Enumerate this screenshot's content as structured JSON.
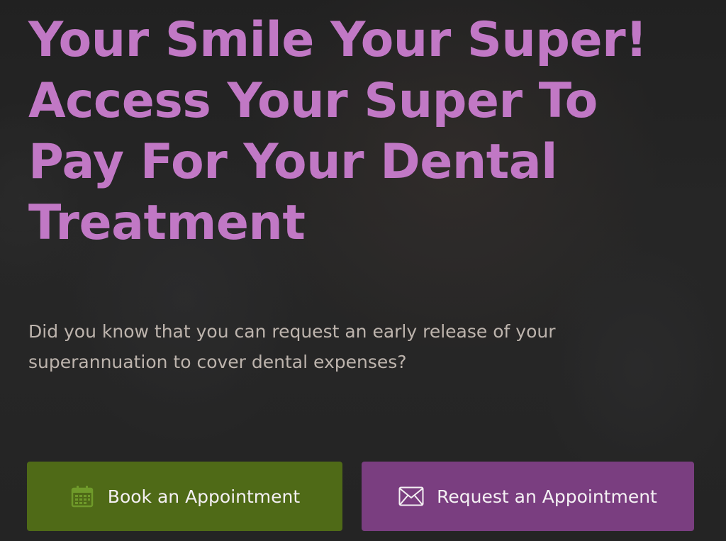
{
  "hero": {
    "headline_lines": [
      "Your Smile Your Super!",
      "Access Your Super To",
      "Pay For Your Dental",
      "Treatment"
    ],
    "intro_lines": [
      "Did you know that you can request an early release of your",
      "superannuation to cover dental expenses?"
    ]
  },
  "buttons": {
    "book": {
      "label": "Book an Appointment",
      "icon": "calendar-icon",
      "color": "#4f6a17"
    },
    "request": {
      "label": "Request an Appointment",
      "icon": "envelope-icon",
      "color": "#7a3e80"
    }
  },
  "colors": {
    "headline": "#c178c5",
    "intro_text": "#bdb4ad",
    "button_text": "#f4f0f3"
  }
}
